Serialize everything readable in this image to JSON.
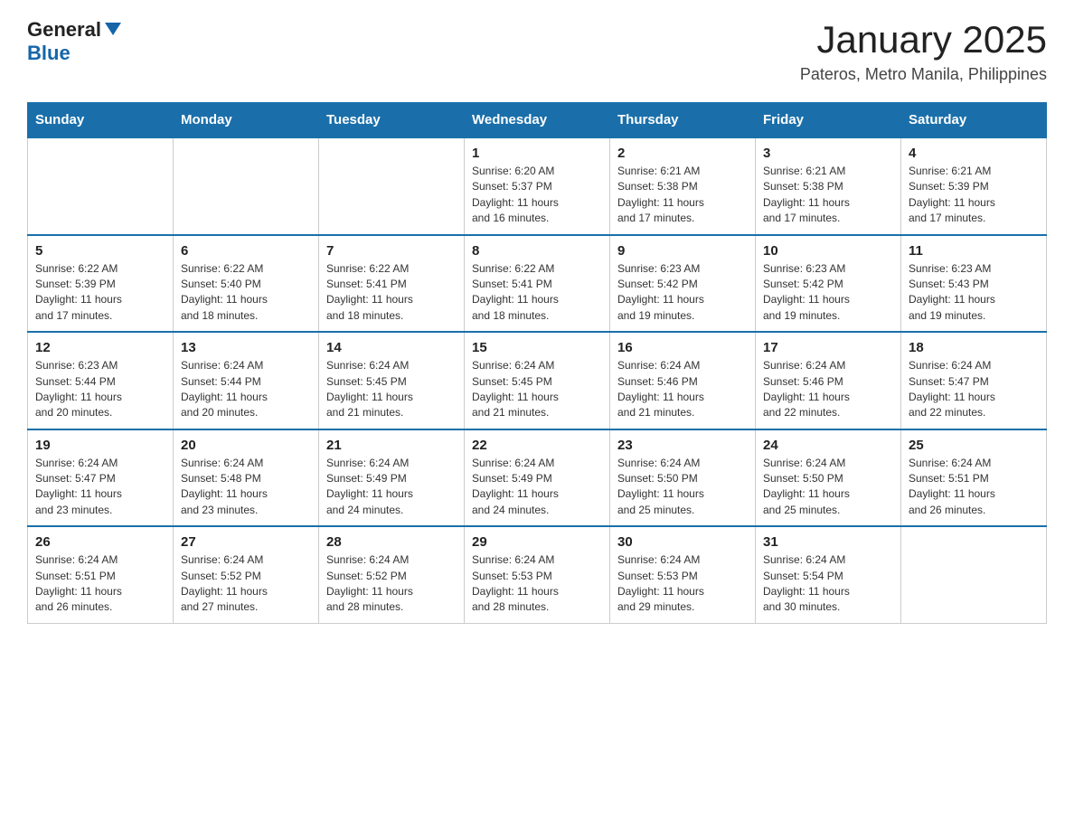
{
  "header": {
    "logo_general": "General",
    "logo_blue": "Blue",
    "month_year": "January 2025",
    "location": "Pateros, Metro Manila, Philippines"
  },
  "days_of_week": [
    "Sunday",
    "Monday",
    "Tuesday",
    "Wednesday",
    "Thursday",
    "Friday",
    "Saturday"
  ],
  "weeks": [
    [
      null,
      null,
      null,
      {
        "day": "1",
        "sunrise": "6:20 AM",
        "sunset": "5:37 PM",
        "daylight": "11 hours and 16 minutes."
      },
      {
        "day": "2",
        "sunrise": "6:21 AM",
        "sunset": "5:38 PM",
        "daylight": "11 hours and 17 minutes."
      },
      {
        "day": "3",
        "sunrise": "6:21 AM",
        "sunset": "5:38 PM",
        "daylight": "11 hours and 17 minutes."
      },
      {
        "day": "4",
        "sunrise": "6:21 AM",
        "sunset": "5:39 PM",
        "daylight": "11 hours and 17 minutes."
      }
    ],
    [
      {
        "day": "5",
        "sunrise": "6:22 AM",
        "sunset": "5:39 PM",
        "daylight": "11 hours and 17 minutes."
      },
      {
        "day": "6",
        "sunrise": "6:22 AM",
        "sunset": "5:40 PM",
        "daylight": "11 hours and 18 minutes."
      },
      {
        "day": "7",
        "sunrise": "6:22 AM",
        "sunset": "5:41 PM",
        "daylight": "11 hours and 18 minutes."
      },
      {
        "day": "8",
        "sunrise": "6:22 AM",
        "sunset": "5:41 PM",
        "daylight": "11 hours and 18 minutes."
      },
      {
        "day": "9",
        "sunrise": "6:23 AM",
        "sunset": "5:42 PM",
        "daylight": "11 hours and 19 minutes."
      },
      {
        "day": "10",
        "sunrise": "6:23 AM",
        "sunset": "5:42 PM",
        "daylight": "11 hours and 19 minutes."
      },
      {
        "day": "11",
        "sunrise": "6:23 AM",
        "sunset": "5:43 PM",
        "daylight": "11 hours and 19 minutes."
      }
    ],
    [
      {
        "day": "12",
        "sunrise": "6:23 AM",
        "sunset": "5:44 PM",
        "daylight": "11 hours and 20 minutes."
      },
      {
        "day": "13",
        "sunrise": "6:24 AM",
        "sunset": "5:44 PM",
        "daylight": "11 hours and 20 minutes."
      },
      {
        "day": "14",
        "sunrise": "6:24 AM",
        "sunset": "5:45 PM",
        "daylight": "11 hours and 21 minutes."
      },
      {
        "day": "15",
        "sunrise": "6:24 AM",
        "sunset": "5:45 PM",
        "daylight": "11 hours and 21 minutes."
      },
      {
        "day": "16",
        "sunrise": "6:24 AM",
        "sunset": "5:46 PM",
        "daylight": "11 hours and 21 minutes."
      },
      {
        "day": "17",
        "sunrise": "6:24 AM",
        "sunset": "5:46 PM",
        "daylight": "11 hours and 22 minutes."
      },
      {
        "day": "18",
        "sunrise": "6:24 AM",
        "sunset": "5:47 PM",
        "daylight": "11 hours and 22 minutes."
      }
    ],
    [
      {
        "day": "19",
        "sunrise": "6:24 AM",
        "sunset": "5:47 PM",
        "daylight": "11 hours and 23 minutes."
      },
      {
        "day": "20",
        "sunrise": "6:24 AM",
        "sunset": "5:48 PM",
        "daylight": "11 hours and 23 minutes."
      },
      {
        "day": "21",
        "sunrise": "6:24 AM",
        "sunset": "5:49 PM",
        "daylight": "11 hours and 24 minutes."
      },
      {
        "day": "22",
        "sunrise": "6:24 AM",
        "sunset": "5:49 PM",
        "daylight": "11 hours and 24 minutes."
      },
      {
        "day": "23",
        "sunrise": "6:24 AM",
        "sunset": "5:50 PM",
        "daylight": "11 hours and 25 minutes."
      },
      {
        "day": "24",
        "sunrise": "6:24 AM",
        "sunset": "5:50 PM",
        "daylight": "11 hours and 25 minutes."
      },
      {
        "day": "25",
        "sunrise": "6:24 AM",
        "sunset": "5:51 PM",
        "daylight": "11 hours and 26 minutes."
      }
    ],
    [
      {
        "day": "26",
        "sunrise": "6:24 AM",
        "sunset": "5:51 PM",
        "daylight": "11 hours and 26 minutes."
      },
      {
        "day": "27",
        "sunrise": "6:24 AM",
        "sunset": "5:52 PM",
        "daylight": "11 hours and 27 minutes."
      },
      {
        "day": "28",
        "sunrise": "6:24 AM",
        "sunset": "5:52 PM",
        "daylight": "11 hours and 28 minutes."
      },
      {
        "day": "29",
        "sunrise": "6:24 AM",
        "sunset": "5:53 PM",
        "daylight": "11 hours and 28 minutes."
      },
      {
        "day": "30",
        "sunrise": "6:24 AM",
        "sunset": "5:53 PM",
        "daylight": "11 hours and 29 minutes."
      },
      {
        "day": "31",
        "sunrise": "6:24 AM",
        "sunset": "5:54 PM",
        "daylight": "11 hours and 30 minutes."
      },
      null
    ]
  ]
}
